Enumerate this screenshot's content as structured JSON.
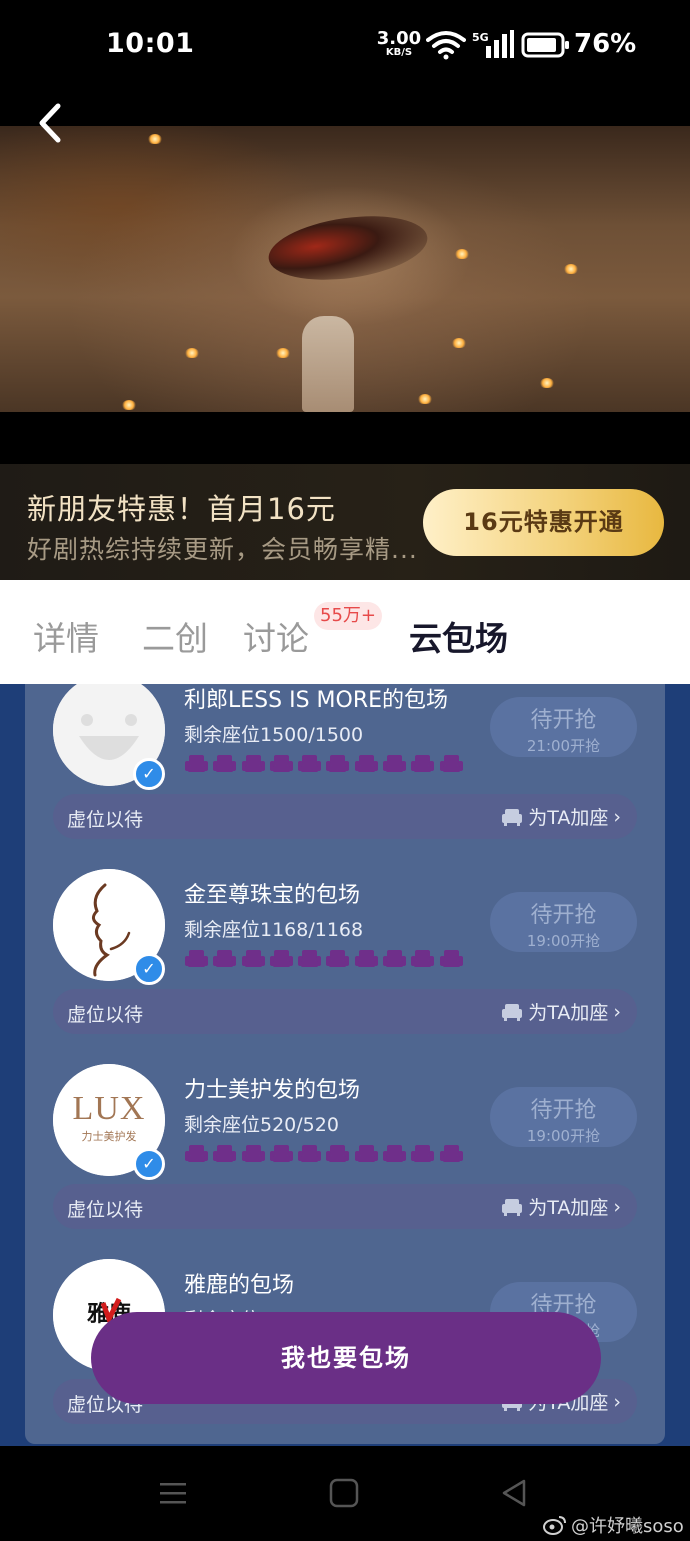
{
  "status_bar": {
    "time": "10:01",
    "net_speed_value": "3.00",
    "net_speed_unit": "KB/S",
    "network_type": "5G",
    "battery": "76%"
  },
  "promo": {
    "title": "新朋友特惠！首月16元",
    "subtitle": "好剧热综持续更新，会员畅享精...",
    "button": "16元特惠开通"
  },
  "tabs": [
    {
      "label": "详情",
      "active": false
    },
    {
      "label": "二创",
      "active": false
    },
    {
      "label": "讨论",
      "active": false,
      "badge": "55万+"
    },
    {
      "label": "云包场",
      "active": true
    }
  ],
  "cards": [
    {
      "title": "利郎LESS IS MORE的包场",
      "seats": "剩余座位1500/1500",
      "grab": "待开抢",
      "grab_time": "21:00开抢",
      "virtual": "虚位以待",
      "seat_link": "为TA加座"
    },
    {
      "title": "金至尊珠宝的包场",
      "seats": "剩余座位1168/1168",
      "grab": "待开抢",
      "grab_time": "19:00开抢",
      "virtual": "虚位以待",
      "seat_link": "为TA加座"
    },
    {
      "title": "力士美护发的包场",
      "seats": "剩余座位520/520",
      "grab": "待开抢",
      "grab_time": "19:00开抢",
      "virtual": "虚位以待",
      "seat_link": "为TA加座",
      "logo_text": "LUX",
      "logo_sub": "力士美护发"
    },
    {
      "title": "雅鹿的包场",
      "seats": "剩余座位700/700",
      "grab": "待开抢",
      "grab_time": "19:00开抢",
      "virtual": "虚位以待",
      "seat_link": "为TA加座",
      "logo_text": "雅鹿"
    }
  ],
  "fab": {
    "label": "我也要包场"
  },
  "watermark": "@许妤曦soso",
  "colors": {
    "panel": "#4f6690",
    "background": "#1e3e78",
    "fab": "#6a2f86",
    "promo_button": "#f4d480",
    "seat": "#6f2f8a"
  }
}
